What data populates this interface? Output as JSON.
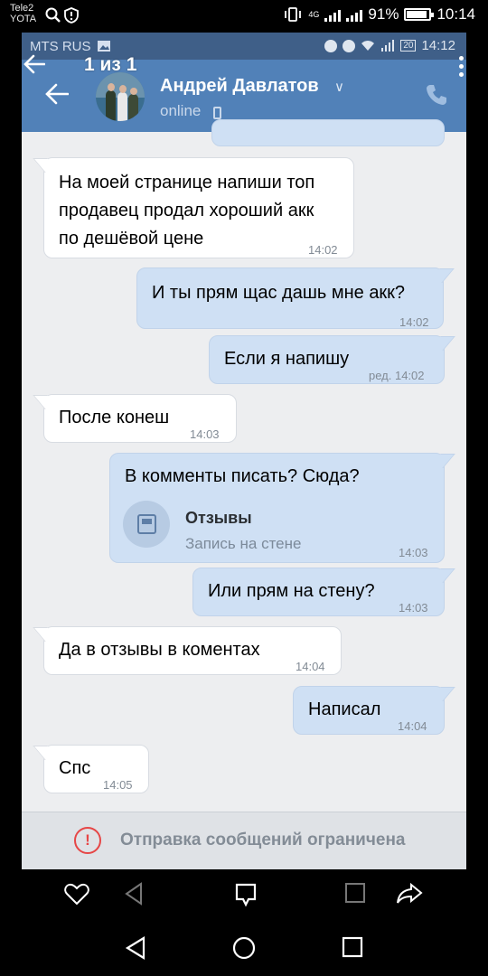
{
  "phone_status": {
    "carrier1": "Tele2",
    "carrier2": "YOTA",
    "network_label": "4G",
    "battery": "91%",
    "time": "10:14",
    "battery_level": 0.91
  },
  "inner_status": {
    "operator": "MTS RUS",
    "battery": "20",
    "time": "14:12"
  },
  "viewer": {
    "counter": "1 из 1"
  },
  "chat_header": {
    "name": "Андрей Давлатов",
    "status": "online"
  },
  "messages": [
    {
      "dir": "in",
      "text": "На моей странице напиши топ\nпродавец продал хороший акк\nпо дешёвой цене",
      "time": "14:02"
    },
    {
      "dir": "out",
      "text": "И ты прям щас дашь мне акк?",
      "time": "14:02"
    },
    {
      "dir": "out",
      "text": "Если я напишу",
      "time": "ред. 14:02"
    },
    {
      "dir": "in",
      "text": "После конеш",
      "time": "14:03"
    },
    {
      "dir": "out",
      "text": "В комменты писать? Сюда?",
      "time": "14:03",
      "attachment": {
        "title": "Отзывы",
        "subtitle": "Запись на стене"
      }
    },
    {
      "dir": "out",
      "text": "Или прям на стену?",
      "time": "14:03"
    },
    {
      "dir": "in",
      "text": "Да в отзывы в коментах",
      "time": "14:04"
    },
    {
      "dir": "out",
      "text": "Написал",
      "time": "14:04"
    },
    {
      "dir": "in",
      "text": "Спс",
      "time": "14:05"
    }
  ],
  "restriction": {
    "text": "Отправка сообщений ограничена"
  },
  "colors": {
    "header": "#5181b8",
    "outgoing_bubble": "#cfe0f4",
    "incoming_bubble": "#ffffff",
    "warning": "#e64646"
  }
}
